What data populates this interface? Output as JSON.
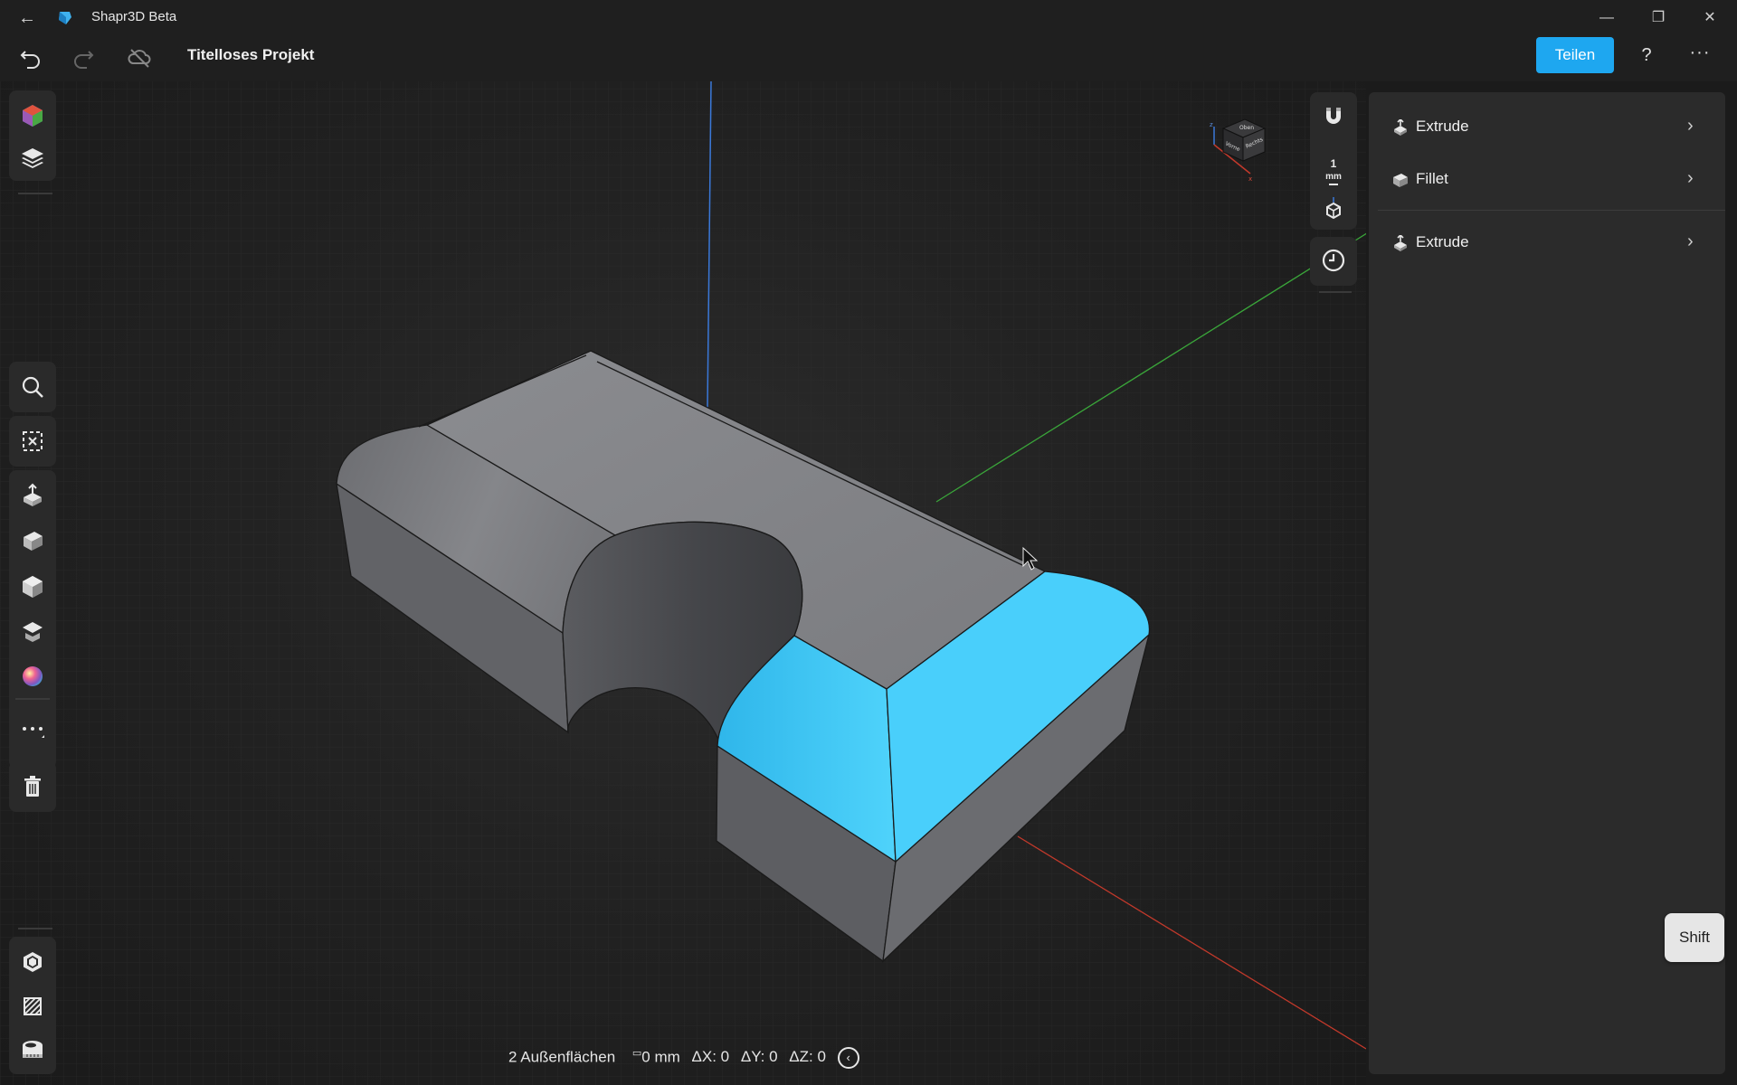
{
  "window": {
    "app_name": "Shapr3D Beta",
    "back_icon": "back-arrow-icon",
    "minimize_icon": "minimize-icon",
    "restore_icon": "restore-icon",
    "close_icon": "close-icon"
  },
  "toolbar": {
    "project_title": "Titelloses Projekt",
    "undo_icon": "undo-icon",
    "redo_icon": "redo-icon",
    "cloud_icon": "cloud-offline-icon",
    "share_label": "Teilen",
    "help_label": "?",
    "more_label": "···"
  },
  "left_toolbar": {
    "top_group": [
      "sketch-cube-icon",
      "layers-icon"
    ],
    "tools": [
      "search-icon",
      "deselect-icon",
      "extrude-icon",
      "fillet-icon",
      "shell-icon",
      "chamfer-icon",
      "appearance-icon",
      "more-tools-icon",
      "delete-icon"
    ],
    "bottom_group": [
      "visibility-icon",
      "section-icon",
      "measure-icon"
    ]
  },
  "right_tools": {
    "scale_value": "1",
    "scale_unit": "mm",
    "icons": [
      "snap-magnet-icon",
      "view-axes-icon",
      "history-icon"
    ]
  },
  "view_cube": {
    "faces": [
      "Oben",
      "Rechts",
      "Vorne"
    ]
  },
  "history": {
    "items": [
      {
        "label": "Extrude",
        "icon": "extrude-icon"
      },
      {
        "label": "Fillet",
        "icon": "fillet-icon"
      },
      {
        "label": "Extrude",
        "icon": "extrude-icon"
      }
    ]
  },
  "status": {
    "selection": "2 Außenflächen",
    "distance": "0 mm",
    "dx": "ΔX: 0",
    "dy": "ΔY: 0",
    "dz": "ΔZ: 0"
  },
  "shift_key": {
    "label": "Shift"
  },
  "colors": {
    "accent": "#1ea7f0",
    "selection": "#3fc6f5",
    "body": "#7a7b7f",
    "background": "#1b1b1b"
  }
}
